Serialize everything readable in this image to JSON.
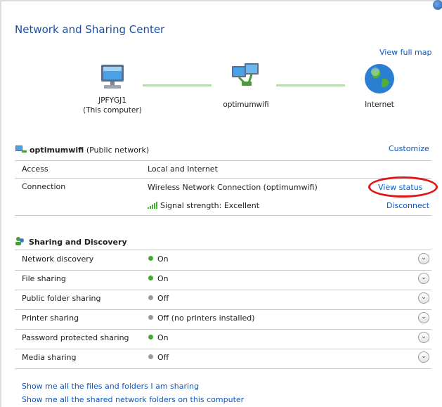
{
  "window": {
    "title": "Network and Sharing Center"
  },
  "map": {
    "view_full_map": "View full map",
    "computer_name": "JPFYGJ1",
    "computer_sub": "(This computer)",
    "network_name": "optimumwifi",
    "internet_label": "Internet"
  },
  "network": {
    "name": "optimumwifi",
    "type": "(Public network)",
    "customize": "Customize",
    "access_label": "Access",
    "access_value": "Local and Internet",
    "connection_label": "Connection",
    "connection_value": "Wireless Network Connection (optimumwifi)",
    "view_status": "View status",
    "signal_text": "Signal strength: Excellent",
    "disconnect": "Disconnect"
  },
  "sharing": {
    "title": "Sharing and Discovery",
    "rows": [
      {
        "label": "Network discovery",
        "value": "On",
        "status": "on"
      },
      {
        "label": "File sharing",
        "value": "On",
        "status": "on"
      },
      {
        "label": "Public folder sharing",
        "value": "Off",
        "status": "off"
      },
      {
        "label": "Printer sharing",
        "value": "Off (no printers installed)",
        "status": "off"
      },
      {
        "label": "Password protected sharing",
        "value": "On",
        "status": "on"
      },
      {
        "label": "Media sharing",
        "value": "Off",
        "status": "off"
      }
    ]
  },
  "links": {
    "files": "Show me all the files and folders I am sharing",
    "folders": "Show me all the shared network folders on this computer"
  },
  "colors": {
    "link": "#0a59c4",
    "on": "#3fae2a",
    "off": "#9a9a9a",
    "highlight": "#e01818"
  }
}
